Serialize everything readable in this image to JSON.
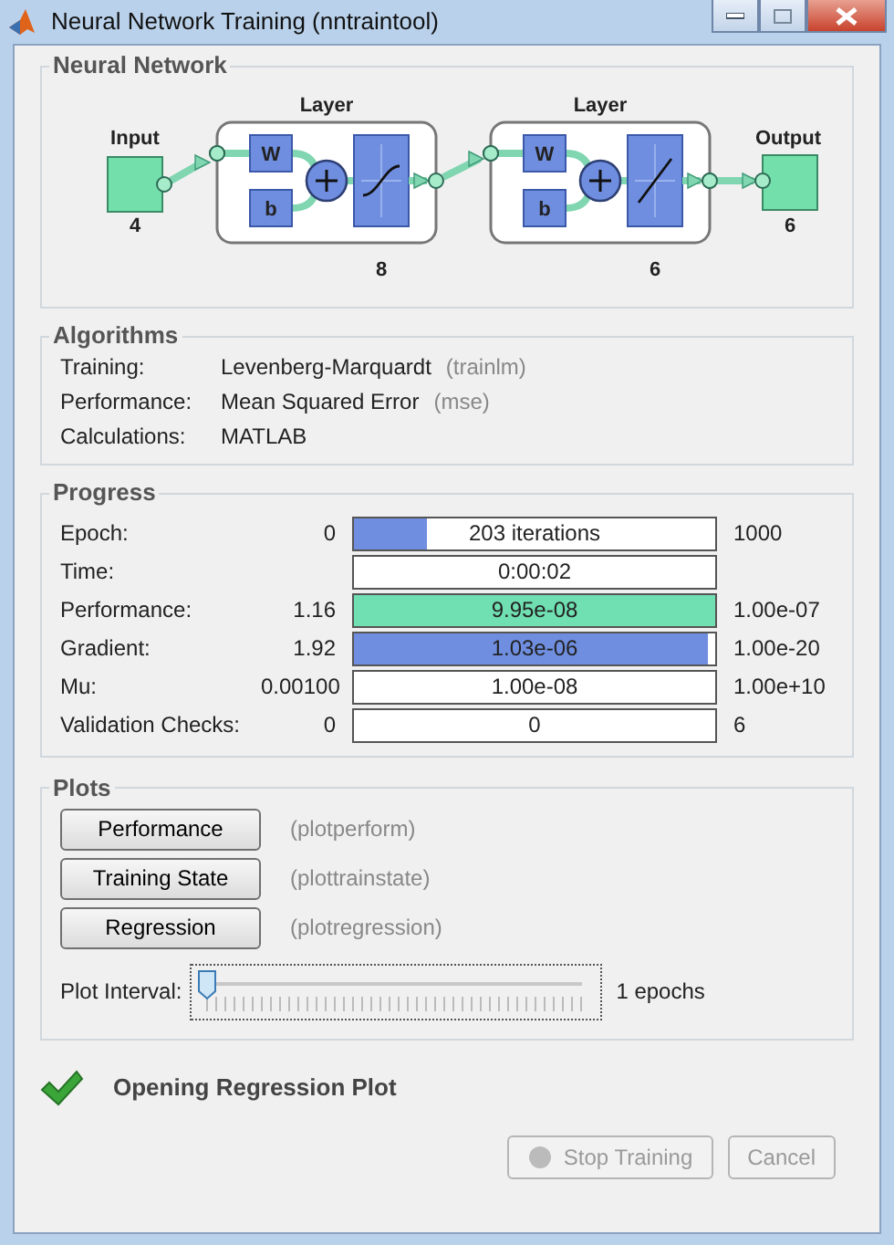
{
  "window": {
    "title": "Neural Network Training (nntraintool)"
  },
  "network": {
    "title": "Neural Network",
    "input": {
      "label": "Input",
      "size": "4"
    },
    "layers": [
      {
        "label": "Layer",
        "size": "8",
        "weight": "W",
        "bias": "b",
        "kind": "sigmoid"
      },
      {
        "label": "Layer",
        "size": "6",
        "weight": "W",
        "bias": "b",
        "kind": "linear"
      }
    ],
    "output": {
      "label": "Output",
      "size": "6"
    }
  },
  "algorithms": {
    "title": "Algorithms",
    "rows": [
      {
        "label": "Training:",
        "value": "Levenberg-Marquardt",
        "function": "(trainlm)"
      },
      {
        "label": "Performance:",
        "value": "Mean Squared Error",
        "function": "(mse)"
      },
      {
        "label": "Calculations:",
        "value": "MATLAB"
      }
    ]
  },
  "progress": {
    "title": "Progress",
    "rows": [
      {
        "label": "Epoch:",
        "min": "0",
        "level": 0.2,
        "text": "203 iterations",
        "max": "1000",
        "color": "#6f8ee0"
      },
      {
        "label": "Time:",
        "level": 0,
        "text": "0:00:02"
      },
      {
        "label": "Performance:",
        "min": "1.16",
        "level": 1,
        "text": "9.95e-08",
        "max": "1.00e-07",
        "color": "#70dfb2"
      },
      {
        "label": "Gradient:",
        "min": "1.92",
        "level": 0.98,
        "text": "1.03e-06",
        "max": "1.00e-20",
        "color": "#6f8ee0"
      },
      {
        "label": "Mu:",
        "min": "0.00100",
        "level": 0,
        "text": "1.00e-08",
        "max": "1.00e+10"
      },
      {
        "label": "Validation Checks:",
        "min": "0",
        "level": 0,
        "text": "0",
        "max": "6"
      }
    ]
  },
  "plots": {
    "title": "Plots",
    "buttons": [
      {
        "label": "Performance",
        "function": "(plotperform)"
      },
      {
        "label": "Training State",
        "function": "(plottrainstate)"
      },
      {
        "label": "Regression",
        "function": "(plotregression)"
      }
    ],
    "interval": {
      "label": "Plot Interval:",
      "level": 0,
      "reading": "1 epochs"
    }
  },
  "status": {
    "text": "Opening Regression Plot"
  },
  "buttons": [
    {
      "label": "Stop Training",
      "disabled": true
    },
    {
      "label": "Cancel",
      "disabled": true
    }
  ]
}
